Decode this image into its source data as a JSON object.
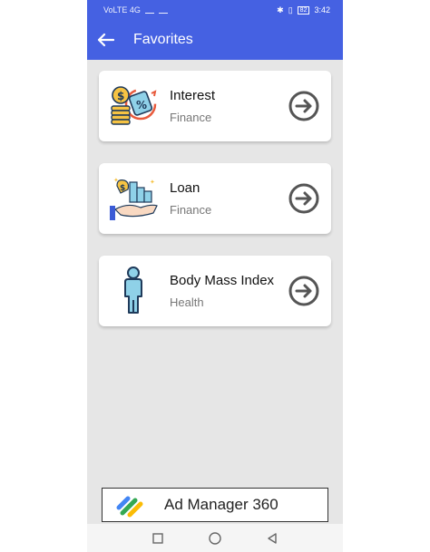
{
  "status_bar": {
    "left_text": "VoLTE 4G",
    "battery": "82",
    "time": "3:42"
  },
  "app_bar": {
    "title": "Favorites",
    "back_icon": "arrow-left-icon"
  },
  "favorites": [
    {
      "title": "Interest",
      "category": "Finance",
      "icon": "interest-coins-icon"
    },
    {
      "title": "Loan",
      "category": "Finance",
      "icon": "loan-hand-icon"
    },
    {
      "title": "Body Mass Index",
      "category": "Health",
      "icon": "person-icon"
    }
  ],
  "ad": {
    "text": "Ad Manager 360"
  },
  "colors": {
    "primary": "#4561e2",
    "background": "#e6e6e6",
    "arrow": "#555555"
  }
}
